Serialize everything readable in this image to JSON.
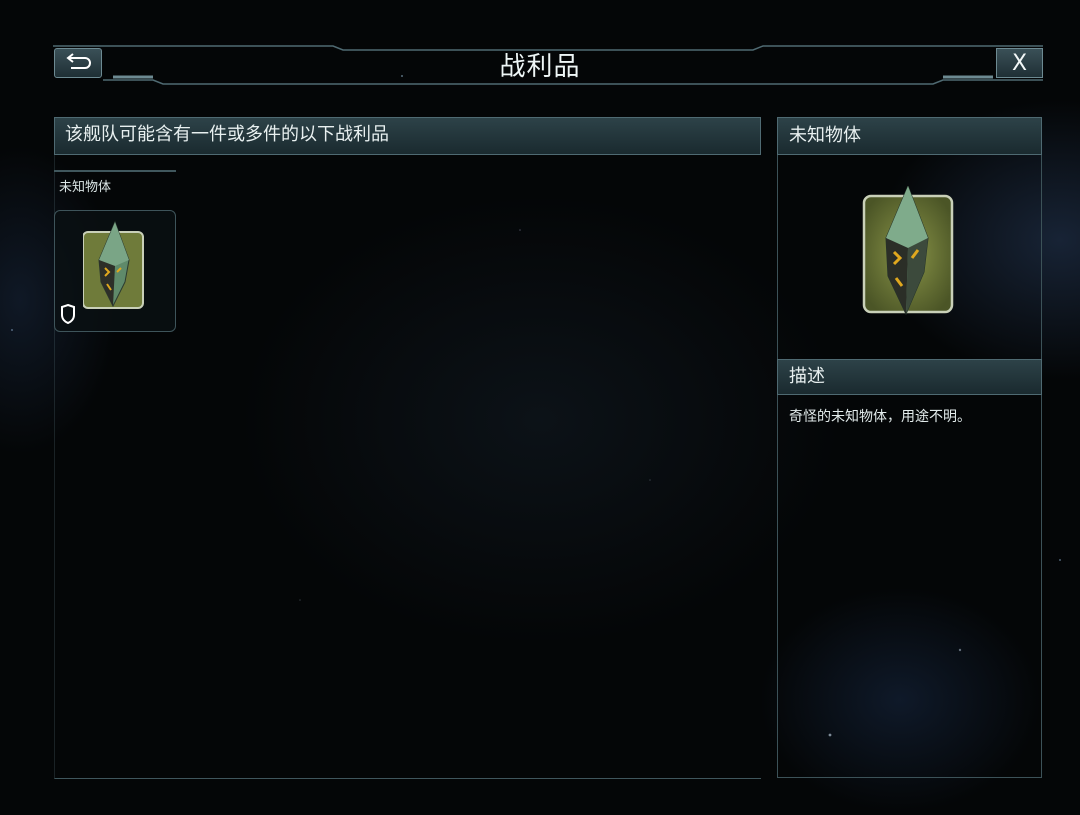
{
  "header": {
    "title": "战利品",
    "back_icon": "return-arrow-icon",
    "close_label": "X"
  },
  "loot_panel": {
    "heading": "该舰队可能含有一件或多件的以下战利品",
    "items": [
      {
        "name": "未知物体",
        "icon": "unknown-object-icon",
        "badge_icon": "shield-icon"
      }
    ]
  },
  "detail_panel": {
    "item_name": "未知物体",
    "description_heading": "描述",
    "description": "奇怪的未知物体，用途不明。"
  },
  "colors": {
    "panel_header": "#2d4248",
    "panel_border": "#4f6a72",
    "item_glow": "#e0a81e",
    "item_body": "#5f8a6a"
  }
}
